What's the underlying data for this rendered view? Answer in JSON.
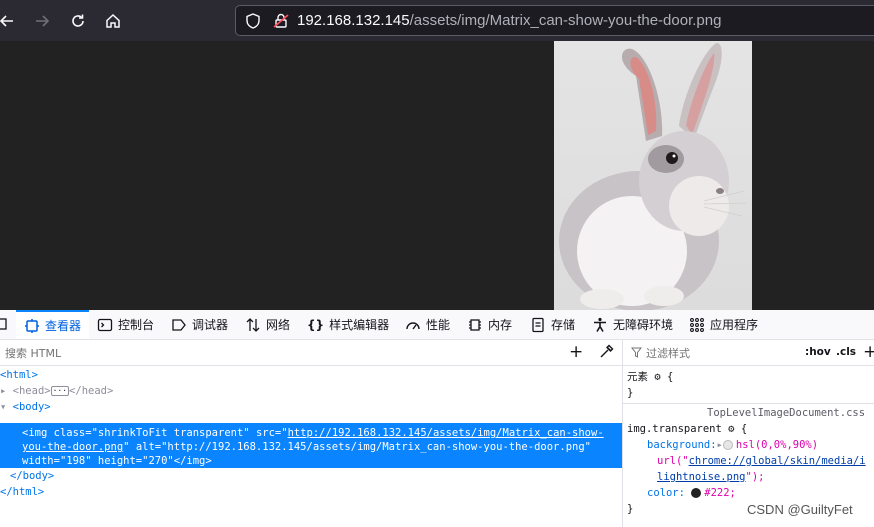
{
  "browser": {
    "url_host": "192.168.132.145",
    "url_path": "/assets/img/Matrix_can-show-you-the-door.png"
  },
  "devtools": {
    "tabs": [
      {
        "label": "查看器",
        "icon": "inspector-icon",
        "active": true
      },
      {
        "label": "控制台",
        "icon": "console-icon"
      },
      {
        "label": "调试器",
        "icon": "debugger-icon"
      },
      {
        "label": "网络",
        "icon": "network-icon"
      },
      {
        "label": "样式编辑器",
        "icon": "style-editor-icon"
      },
      {
        "label": "性能",
        "icon": "performance-icon"
      },
      {
        "label": "内存",
        "icon": "memory-icon"
      },
      {
        "label": "存储",
        "icon": "storage-icon"
      },
      {
        "label": "无障碍环境",
        "icon": "accessibility-icon"
      },
      {
        "label": "应用程序",
        "icon": "application-icon"
      }
    ],
    "markup_search_placeholder": "搜索 HTML",
    "markup": {
      "html_open": "<html>",
      "head_open": "<head>",
      "head_close": "</head>",
      "body_open": "<body>",
      "img_tag_open": "<img",
      "img_class_attr": "class=",
      "img_class_val": "\"shrinkToFit transparent\"",
      "img_src_attr": "src=",
      "img_src_quote": "\"",
      "img_src_link1": "http://192.168.132.145/assets/img/Matrix_can-show-",
      "img_src_link2": "you-the-door.png",
      "img_alt_attr": "alt=",
      "img_alt_val": "\"http://192.168.132.145/assets/img/Matrix_can-show-you-the-door.png\"",
      "img_width_attr": "width=",
      "img_width_val": "\"198\"",
      "img_height_attr": "height=",
      "img_height_val": "\"270\"",
      "img_close": "</img>",
      "body_close": "</body>",
      "html_close": "</html>"
    },
    "rules_filter_placeholder": "过滤样式",
    "hov_label": ":hov",
    "cls_label": ".cls",
    "rules": {
      "element_selector": "元素",
      "open_brace": "{",
      "close_brace": "}",
      "source": "TopLevelImageDocument.css",
      "selector": "img.transparent",
      "background_prop": "background:",
      "background_val": "hsl(0,0%,90%)",
      "background_url_prefix": "url(\"",
      "background_url_1": "chrome://global/skin/media/i",
      "background_url_2": "lightnoise.png",
      "background_url_suffix": "\");",
      "color_prop": "color:",
      "color_val": "#222;"
    }
  },
  "watermark": "CSDN @GuiltyFet",
  "colors": {
    "accent": "#0a84ff",
    "tag": "#0074e8",
    "attr": "#dd00a9",
    "bg_swatch": "#e6e6e6",
    "color_swatch": "#222222"
  }
}
